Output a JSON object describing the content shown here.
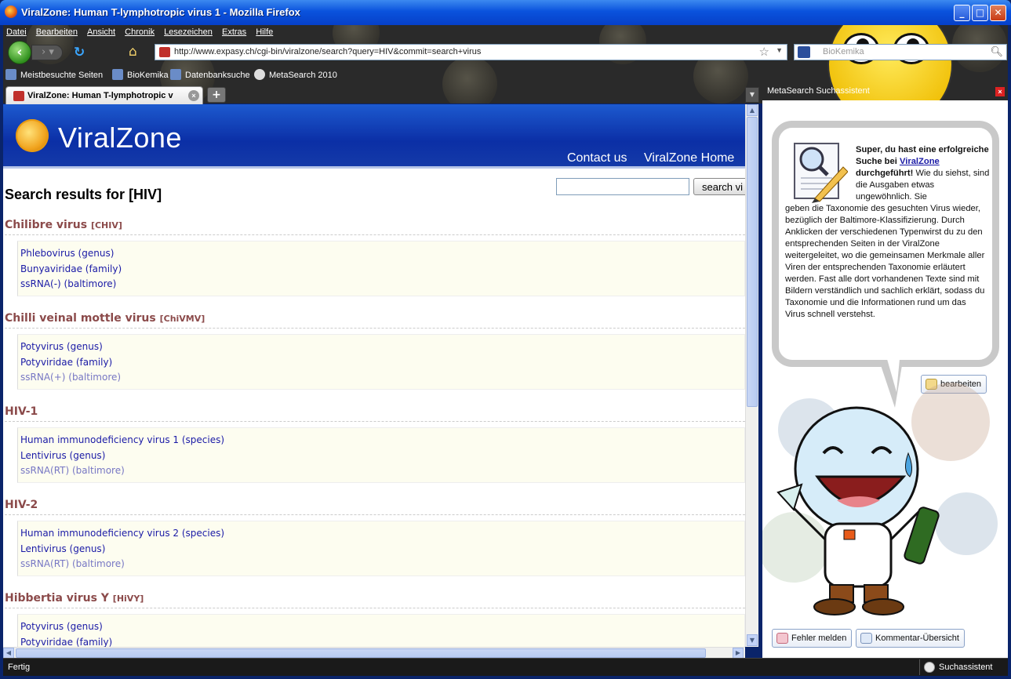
{
  "window": {
    "title": "ViralZone: Human T-lymphotropic virus 1 - Mozilla Firefox",
    "minimize": "_",
    "maximize": "□",
    "close": "✕"
  },
  "menu": [
    "Datei",
    "Bearbeiten",
    "Ansicht",
    "Chronik",
    "Lesezeichen",
    "Extras",
    "Hilfe"
  ],
  "nav": {
    "url": "http://www.expasy.ch/cgi-bin/viralzone/search?query=HIV&commit=search+virus",
    "search_placeholder": "BioKemika"
  },
  "bookmarks": [
    "Meistbesuchte Seiten",
    "BioKemika",
    "Datenbanksuche",
    "MetaSearch 2010"
  ],
  "tab": {
    "label": "ViralZone: Human T-lymphotropic v",
    "new_tab": "+"
  },
  "sidebar_title": "MetaSearch Suchassistent",
  "page": {
    "site_title": "ViralZone",
    "nav_contact": "Contact us",
    "nav_home": "ViralZone Home",
    "search_button": "search vi",
    "heading": "Search results for [HIV]"
  },
  "results": [
    {
      "name": "Chilibre virus",
      "abbr": "[CHIV]",
      "links": [
        "Phlebovirus (genus)",
        "Bunyaviridae (family)",
        "ssRNA(-) (baltimore)"
      ],
      "visited": [
        false,
        false,
        false
      ]
    },
    {
      "name": "Chilli veinal mottle virus",
      "abbr": "[ChiVMV]",
      "links": [
        "Potyvirus (genus)",
        "Potyviridae (family)",
        "ssRNA(+) (baltimore)"
      ],
      "visited": [
        false,
        false,
        true
      ]
    },
    {
      "name": "HIV-1",
      "abbr": "",
      "links": [
        "Human immunodeficiency virus 1 (species)",
        "Lentivirus (genus)",
        "ssRNA(RT) (baltimore)"
      ],
      "visited": [
        false,
        false,
        true
      ]
    },
    {
      "name": "HIV-2",
      "abbr": "",
      "links": [
        "Human immunodeficiency virus 2 (species)",
        "Lentivirus (genus)",
        "ssRNA(RT) (baltimore)"
      ],
      "visited": [
        false,
        false,
        true
      ]
    },
    {
      "name": "Hibbertia virus Y",
      "abbr": "[HiVY]",
      "links": [
        "Potyvirus (genus)",
        "Potyviridae (family)",
        ""
      ],
      "visited": [
        false,
        false,
        false
      ]
    }
  ],
  "assistant": {
    "lead_bold": "Super, du hast eine erfolgreiche Suche bei",
    "link": "ViralZone",
    "lead_bold2": "durchgeführt!",
    "lead_rest": "Wie du siehst, sind die Ausgaben etwas ungewöhnlich. Sie",
    "body": "geben die Taxonomie des gesuchten Virus wieder, bezüglich der Baltimore-Klassifizierung. Durch Anklicken der verschiedenen Typenwirst du zu den entsprechenden Seiten in der ViralZone weitergeleitet, wo die gemeinsamen Merkmale aller Viren der entsprechenden Taxonomie erläutert werden. Fast alle dort vorhandenen Texte sind mit Bildern verständlich und sachlich erklärt, sodass du Taxonomie und die Informationen rund um das Virus schnell verstehst.",
    "edit_button": "bearbeiten",
    "report_button": "Fehler melden",
    "comments_button": "Kommentar-Übersicht"
  },
  "status": {
    "text": "Fertig",
    "assistant": "Suchassistent"
  },
  "colors": {
    "titlebar": "#0a52dd",
    "header_blue": "#1d5acf",
    "result_name": "#8b4a4a",
    "link": "#1a1aa6",
    "visited_link": "#7777c4"
  }
}
